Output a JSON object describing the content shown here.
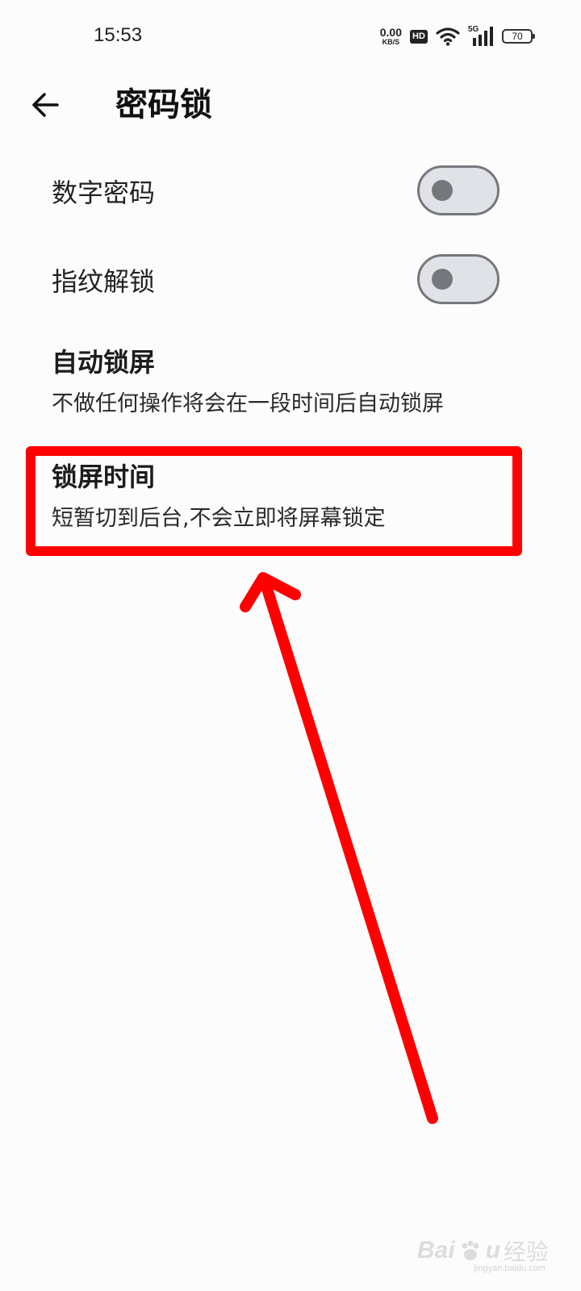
{
  "status_bar": {
    "time": "15:53",
    "net_speed_value": "0.00",
    "net_speed_unit": "KB/S",
    "hd_label": "HD",
    "network_label": "5G",
    "battery_level": "70"
  },
  "header": {
    "title": "密码锁",
    "back_icon": "arrow-left-icon"
  },
  "settings": {
    "digit_password": {
      "label": "数字密码",
      "enabled": false
    },
    "fingerprint_unlock": {
      "label": "指纹解锁",
      "enabled": false
    },
    "auto_lock": {
      "title": "自动锁屏",
      "subtitle": "不做任何操作将会在一段时间后自动锁屏"
    },
    "lock_time": {
      "title": "锁屏时间",
      "subtitle": "短暂切到后台,不会立即将屏幕锁定"
    }
  },
  "annotation": {
    "color": "#ff0000"
  },
  "watermark": {
    "brand": "Bai",
    "brand_end": "u",
    "sub": "经验",
    "url": "jingyan.baidu.com"
  },
  "colors": {
    "background": "#fdfcfd",
    "toggle_track": "#e1e2e7",
    "toggle_border": "#74777c"
  }
}
